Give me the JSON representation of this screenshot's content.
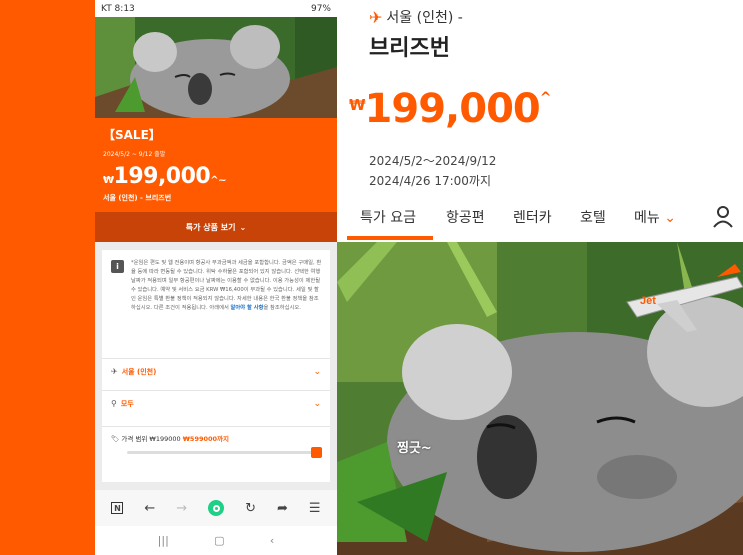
{
  "status_bar": {
    "carrier_time": "KT 8:13",
    "battery": "97%"
  },
  "sale": {
    "title": "【SALE】",
    "dates": "2024/5/2 ~ 9/12 출발",
    "currency": "₩",
    "price": "199,000",
    "price_suffix": "^~",
    "route": "서울 (인천) - 브리즈번",
    "special_button": "특가 상품 보기"
  },
  "notice": {
    "text": "*운임은 편도 및 웹 전용이며 항공사 부과금액과 세금을 포함합니다. 금액은 구매일, 환율 등에 따라 변동될 수 있습니다. 위탁 수하물은 포함되어 있지 않습니다. 선택한 여행 날짜가 적용되며 일부 항공편이나 날짜에는 이용할 수 없습니다. 이용 가능성이 제한될 수 있습니다. 예약 및 서비스 요금 KRW ₩16,400이 부과될 수 있습니다. 세일 및 할인 운임은 특별 환불 정책이 적용되지 않습니다. 자세한 내용은 한국 환불 정책을 참조하십시오. 다른 조건이 적용됩니다. 아래에서",
    "link": "알아야 할 사항",
    "tail": "을 참조하십시오."
  },
  "filters": {
    "origin": "서울 (인천)",
    "destination": "모두",
    "price_label": "가격 범위",
    "price_min": "₩199000",
    "price_max": "₩599000까지"
  },
  "right": {
    "route": "서울 (인천) -",
    "destination": "브리즈번",
    "currency": "₩",
    "price": "199,000",
    "price_sup": "^",
    "dates1": "2024/5/2～2024/9/12",
    "dates2": "2024/4/26 17:00까지",
    "nav": [
      "특가 요금",
      "항공편",
      "렌터카",
      "호텔",
      "메뉴"
    ],
    "caption": "찡긋~"
  },
  "colors": {
    "brand": "#ff5a00",
    "button_dark": "#c84307"
  },
  "icons": [
    "plane-icon",
    "info-icon",
    "location-pin-icon",
    "tag-icon",
    "chevron-down-icon",
    "person-icon",
    "back-icon",
    "forward-icon",
    "refresh-icon",
    "share-icon",
    "menu-icon"
  ]
}
